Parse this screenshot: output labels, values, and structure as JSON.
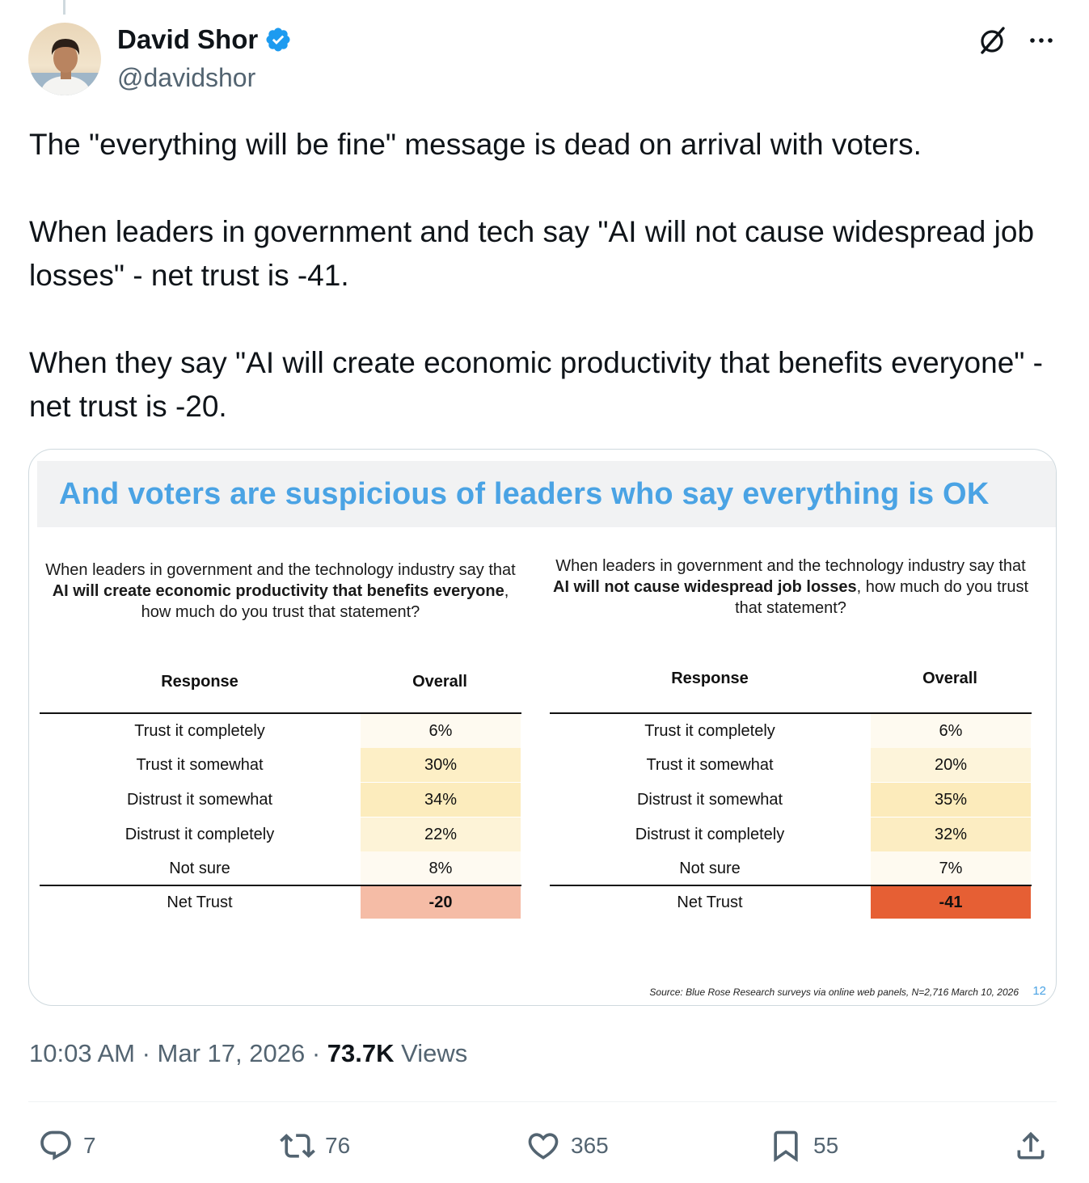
{
  "author": {
    "display_name": "David Shor",
    "handle": "@davidshor",
    "verified": true,
    "verified_color": "#1d9bf0"
  },
  "tweet": {
    "paragraphs": [
      "The \"everything will be fine\" message is dead on arrival with voters.",
      "When leaders in government and tech say \"AI will not cause widespread job losses\" - net trust is -41.",
      "When they say \"AI will create economic productivity that benefits everyone\" - net trust is -20."
    ]
  },
  "slide": {
    "title": "And voters are suspicious of leaders who say everything is OK",
    "title_color": "#4aa3e4",
    "left": {
      "question_pre": "When leaders in government and the technology industry say that ",
      "question_bold": "AI will create economic productivity that benefits everyone",
      "question_post": ", how much do you trust that statement?",
      "col_response": "Response",
      "col_overall": "Overall",
      "rows": [
        {
          "label": "Trust it completely",
          "value": "6%",
          "color": "#fefaf0"
        },
        {
          "label": "Trust it somewhat",
          "value": "30%",
          "color": "#fdefc6"
        },
        {
          "label": "Distrust it somewhat",
          "value": "34%",
          "color": "#fcecbd"
        },
        {
          "label": "Distrust it completely",
          "value": "22%",
          "color": "#fdf3d7"
        },
        {
          "label": "Not sure",
          "value": "8%",
          "color": "#fefaf1"
        }
      ],
      "net_label": "Net Trust",
      "net_value": "-20",
      "net_color": "#f5bca6"
    },
    "right": {
      "question_pre": "When leaders in government and the technology industry say that ",
      "question_bold": "AI will not cause widespread job losses",
      "question_post": ", how much do you trust that statement?",
      "col_response": "Response",
      "col_overall": "Overall",
      "rows": [
        {
          "label": "Trust it completely",
          "value": "6%",
          "color": "#fefaf0"
        },
        {
          "label": "Trust it somewhat",
          "value": "20%",
          "color": "#fdf4da"
        },
        {
          "label": "Distrust it somewhat",
          "value": "35%",
          "color": "#fcebbb"
        },
        {
          "label": "Distrust it completely",
          "value": "32%",
          "color": "#fcedc2"
        },
        {
          "label": "Not sure",
          "value": "7%",
          "color": "#fefaf0"
        }
      ],
      "net_label": "Net Trust",
      "net_value": "-41",
      "net_color": "#e65f34"
    },
    "source": "Source: Blue Rose Research surveys via online web panels, N=2,716 March 10, 2026",
    "page_number": "12"
  },
  "meta": {
    "time": "10:03 AM",
    "sep": " · ",
    "date": "Mar 17, 2026",
    "views_count": "73.7K",
    "views_label": " Views"
  },
  "actions": {
    "replies": "7",
    "reposts": "76",
    "likes": "365",
    "bookmarks": "55"
  }
}
